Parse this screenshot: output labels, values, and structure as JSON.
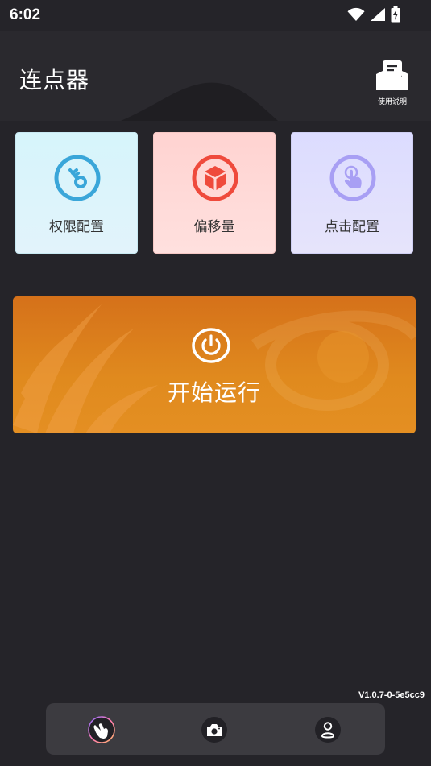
{
  "status_bar": {
    "time": "6:02",
    "icons": [
      "wifi-icon",
      "signal-icon",
      "battery-charging-icon"
    ]
  },
  "header": {
    "title": "连点器",
    "help": {
      "label": "使用说明",
      "icon": "manual-icon"
    }
  },
  "feature_cards": [
    {
      "label": "权限配置",
      "icon": "key-icon",
      "accent": "#3aa6d9"
    },
    {
      "label": "偏移量",
      "icon": "cube-icon",
      "accent": "#ef4a3c"
    },
    {
      "label": "点击配置",
      "icon": "tap-finger-icon",
      "accent": "#a89ff4"
    }
  ],
  "start": {
    "label": "开始运行",
    "icon": "power-icon"
  },
  "version": "V1.0.7-0-5e5cc9",
  "bottom_nav": [
    {
      "name": "clicker",
      "icon": "touch-hand-icon"
    },
    {
      "name": "screenshot",
      "icon": "camera-icon"
    },
    {
      "name": "profile",
      "icon": "user-icon"
    }
  ],
  "colors": {
    "background": "#252429",
    "header": "#2a292e",
    "start_gradient_top": "#d5711a",
    "start_gradient_bottom": "#e48f22",
    "nav": "#3c3b40"
  }
}
